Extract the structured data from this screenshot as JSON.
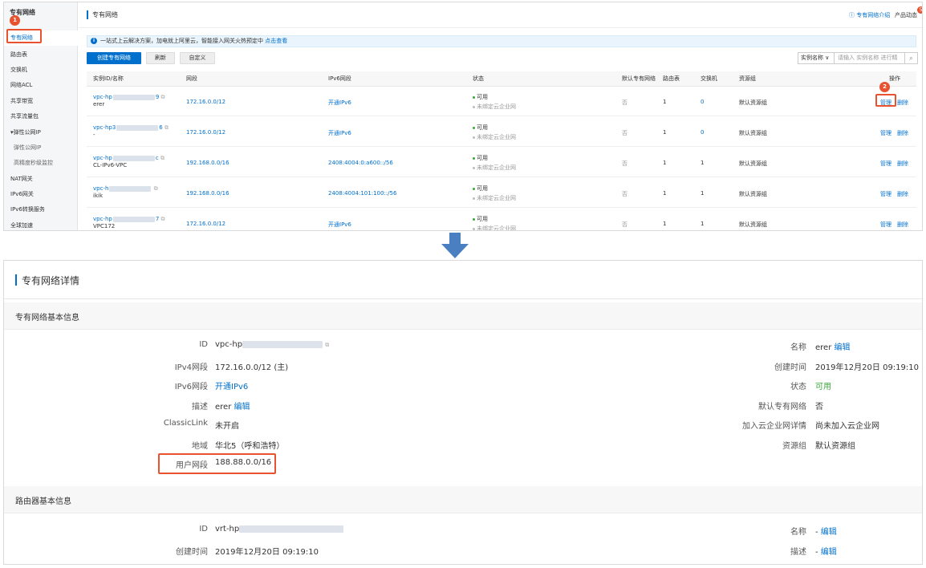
{
  "sidebar": {
    "title": "专有网络",
    "items": [
      {
        "label": "专有网络",
        "active": true
      },
      {
        "label": "路由表"
      },
      {
        "label": "交换机"
      },
      {
        "label": "网络ACL"
      },
      {
        "label": "共享带宽"
      },
      {
        "label": "共享流量包"
      },
      {
        "label": "▾弹性公网IP"
      },
      {
        "label": "弹性公网IP",
        "sub": true
      },
      {
        "label": "高精度秒级监控",
        "sub": true
      },
      {
        "label": "NAT网关"
      },
      {
        "label": "IPv6网关"
      },
      {
        "label": "IPv6转换服务"
      },
      {
        "label": "全球加速"
      }
    ]
  },
  "markers": {
    "step1": "1",
    "step2": "2"
  },
  "header": {
    "title": "专有网络",
    "help_link": "ⓘ 专有网络介绍",
    "product_news": "产品动态",
    "badge": "5"
  },
  "notice": {
    "text": "一站式上云解决方案，加电就上阿里云，智能接入网关火热预定中",
    "link": "点击查看"
  },
  "toolbar": {
    "create": "创建专有网络",
    "refresh": "刷新",
    "customize": "自定义",
    "search_field": "实例名称 ∨",
    "search_placeholder": "请输入 实例名称 进行精",
    "search_icon": "search-icon"
  },
  "table": {
    "columns": [
      "实例ID/名称",
      "网段",
      "IPv6网段",
      "状态",
      "默认专有网络",
      "路由表",
      "交换机",
      "资源组",
      "操作"
    ],
    "rows": [
      {
        "id_pre": "vpc-hp",
        "id_suf": "9",
        "name": "erer",
        "cidr": "172.16.0.0/12",
        "ipv6": "开通IPv6",
        "status": "可用",
        "cen": "未绑定云企业网",
        "default": "否",
        "rt": "1",
        "vsw": "0",
        "rg": "默认资源组",
        "manage": "管理",
        "delete": "删除"
      },
      {
        "id_pre": "vpc-hp3",
        "id_suf": "6",
        "name": "-",
        "cidr": "172.16.0.0/12",
        "ipv6": "开通IPv6",
        "status": "可用",
        "cen": "未绑定云企业网",
        "default": "否",
        "rt": "1",
        "vsw": "0",
        "rg": "默认资源组",
        "manage": "管理",
        "delete": "删除"
      },
      {
        "id_pre": "vpc-hp",
        "id_suf": "c",
        "name": "CL-IPv6-VPC",
        "cidr": "192.168.0.0/16",
        "ipv6": "2408:4004:0:a600::/56",
        "status": "可用",
        "cen": "未绑定云企业网",
        "default": "否",
        "rt": "1",
        "vsw": "1",
        "rg": "默认资源组",
        "manage": "管理",
        "delete": "删除"
      },
      {
        "id_pre": "vpc-h",
        "id_suf": "",
        "name": "ikik",
        "cidr": "192.168.0.0/16",
        "ipv6": "2408:4004:101:100::/56",
        "status": "可用",
        "cen": "未绑定云企业网",
        "default": "否",
        "rt": "1",
        "vsw": "1",
        "rg": "默认资源组",
        "manage": "管理",
        "delete": "删除"
      },
      {
        "id_pre": "vpc-hp",
        "id_suf": "7",
        "name": "VPC172",
        "cidr": "172.16.0.0/12",
        "ipv6": "开通IPv6",
        "status": "可用",
        "cen": "未绑定云企业网",
        "default": "否",
        "rt": "1",
        "vsw": "1",
        "rg": "默认资源组",
        "manage": "管理",
        "delete": "删除"
      }
    ]
  },
  "detail": {
    "title": "专有网络详情",
    "vpc_section": "专有网络基本信息",
    "left": {
      "id_label": "ID",
      "id_value": "vpc-hp",
      "ipv4_label": "IPv4网段",
      "ipv4_value": "172.16.0.0/12 (主)",
      "ipv6_label": "IPv6网段",
      "ipv6_value": "开通IPv6",
      "desc_label": "描述",
      "desc_value": "erer",
      "desc_edit": "编辑",
      "classic_label": "ClassicLink",
      "classic_value": "未开启",
      "region_label": "地域",
      "region_value": "华北5（呼和浩特）",
      "user_cidr_label": "用户网段",
      "user_cidr_value": "188.88.0.0/16"
    },
    "right": {
      "name_label": "名称",
      "name_value": "erer",
      "name_edit": "编辑",
      "created_label": "创建时间",
      "created_value": "2019年12月20日 09:19:10",
      "status_label": "状态",
      "status_value": "可用",
      "default_label": "默认专有网络",
      "default_value": "否",
      "cen_label": "加入云企业网详情",
      "cen_value": "尚未加入云企业网",
      "rg_label": "资源组",
      "rg_value": "默认资源组"
    },
    "router_section": "路由器基本信息",
    "router": {
      "id_label": "ID",
      "id_value": "vrt-hp",
      "created_label": "创建时间",
      "created_value": "2019年12月20日 09:19:10",
      "name_label": "名称",
      "name_value": "-",
      "name_edit": "编辑",
      "desc_label": "描述",
      "desc_value": "-",
      "desc_edit": "编辑"
    }
  }
}
